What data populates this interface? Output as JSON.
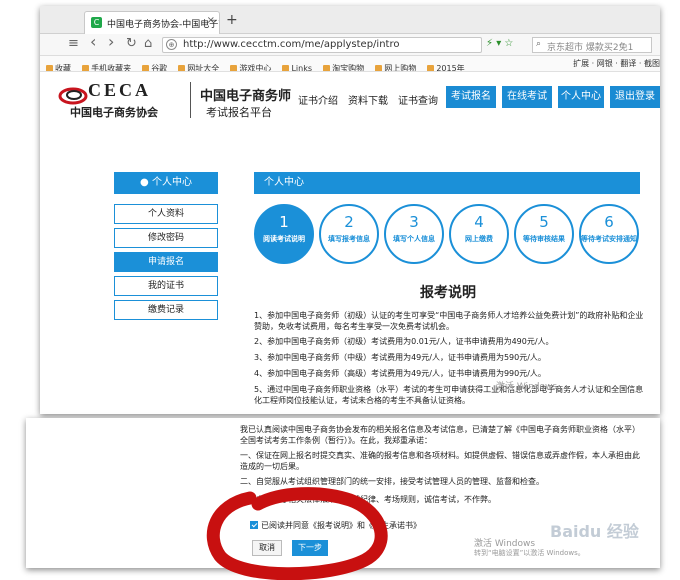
{
  "browser": {
    "logo_letter": "e",
    "tab_title": "中国电子商务协会-中国电子商务",
    "tab_close": "×",
    "new_tab": "+",
    "url": "http://www.cecctm.com/me/applystep/intro",
    "url_tools": "⚡ ▾ ☆",
    "search_text": "京东超市 爆款买2免1",
    "nav_icons": {
      "menu": "≡",
      "back": "‹",
      "forward": "›",
      "refresh": "↻",
      "home": "⌂"
    },
    "bookmarks": [
      "收藏",
      "手机收藏夹",
      "谷歌",
      "网址大全",
      "游戏中心",
      "Links",
      "淘宝购物",
      "网上购物",
      "2015年"
    ],
    "bookmarks_right": "扩展 · 网银 · 翻译 · 截图"
  },
  "site": {
    "logo": "CECA",
    "org_name": "中国电子商务协会",
    "title_line1": "中国电子商务师",
    "title_line2": "考试报名平台",
    "nav": [
      "证书介绍",
      "资料下载",
      "证书查询"
    ],
    "buttons": [
      "考试报名",
      "在线考试",
      "个人中心",
      "退出登录"
    ]
  },
  "sidebar": {
    "header": "个人中心",
    "header_icon": "location-pin-icon",
    "items": [
      {
        "label": "个人资料",
        "active": false
      },
      {
        "label": "修改密码",
        "active": false
      },
      {
        "label": "申请报名",
        "active": true
      },
      {
        "label": "我的证书",
        "active": false
      },
      {
        "label": "缴费记录",
        "active": false
      }
    ]
  },
  "main": {
    "header": "个人中心",
    "steps": [
      {
        "num": "1",
        "label": "阅读考试说明",
        "active": true
      },
      {
        "num": "2",
        "label": "填写报考信息",
        "active": false
      },
      {
        "num": "3",
        "label": "填写个人信息",
        "active": false
      },
      {
        "num": "4",
        "label": "网上缴费",
        "active": false
      },
      {
        "num": "5",
        "label": "等待审核结果",
        "active": false
      },
      {
        "num": "6",
        "label": "等待考试安排通知",
        "active": false
      }
    ],
    "notice_title": "报考说明",
    "notice_lines": [
      "1、参加中国电子商务师（初级）认证的考生可享受“中国电子商务师人才培养公益免费计划”的政府补贴和企业赞助，免收考试费用，每名考生享受一次免费考试机会。",
      "2、参加中国电子商务师（初级）考试费用为0.01元/人，证书申请费用为490元/人。",
      "3、参加中国电子商务师（中级）考试费用为49元/人，证书申请费用为590元/人。",
      "4、参加中国电子商务师（高级）考试费用为49元/人，证书申请费用为990元/人。",
      "5、通过中国电子商务师职业资格（水平）考试的考生可申请获得工业和信息化部电子商务人才认证和全国信息化工程师岗位技能认证，考试未合格的考生不具备认证资格。"
    ],
    "watermark": "激活 Windows"
  },
  "lower": {
    "lines": [
      "我已认真阅读中国电子商务协会发布的相关报名信息及考试信息，已清楚了解《中国电子商务师职业资格（水平）全国考试考务工作条例（暂行）》。在此，我郑重承诺：",
      "一、保证在网上报名时提交真实、准确的报考信息和各项材料。如提供虚假、错误信息或弄虚作假，本人承担由此造成的一切后果。",
      "二、自觉服从考试组织管理部门的统一安排，接受考试管理人员的管理、监督和检查。",
      "三、自觉遵守相关法律法规和考试纪律、考场规则，诚信考试，不作弊。"
    ],
    "agree_text": "已阅读并同意《报考说明》和《考生承诺书》",
    "cancel_label": "取消",
    "next_label": "下一步",
    "watermark_line1": "激活 Windows",
    "watermark_line2": "转到“电脑设置”以激活 Windows。",
    "stamp": "Baidu 经验"
  },
  "colors": {
    "accent": "#1b90d8",
    "annotation": "#c81010"
  }
}
